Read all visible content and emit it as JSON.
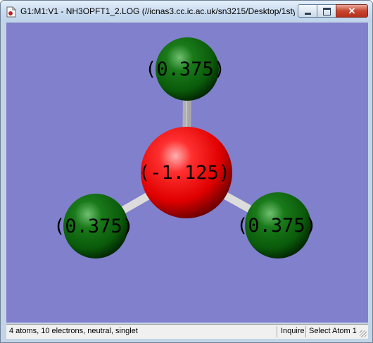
{
  "window": {
    "title": "G1:M1:V1 - NH3OPFT1_2.LOG (//icnas3.cc.ic.ac.uk/sn3215/Desktop/1sty...",
    "icon": "gaussview-document-icon",
    "controls": {
      "minimize": "minimize-icon",
      "maximize": "maximize-icon",
      "close": "close-icon"
    }
  },
  "molecule": {
    "background_color": "#8080cc",
    "atoms": [
      {
        "element": "N",
        "charge_label": "(-1.125)",
        "color": "#ff0000"
      },
      {
        "element": "H",
        "charge_label": "(0.375)",
        "color": "#0a6a0a"
      },
      {
        "element": "H",
        "charge_label": "(0.375)",
        "color": "#0a6a0a"
      },
      {
        "element": "H",
        "charge_label": "(0.375)",
        "color": "#0a6a0a"
      }
    ],
    "bond_color": "#e8e8e8"
  },
  "statusbar": {
    "info": "4 atoms, 10 electrons, neutral, singlet",
    "mode": "Inquire",
    "action": "Select Atom 1"
  }
}
